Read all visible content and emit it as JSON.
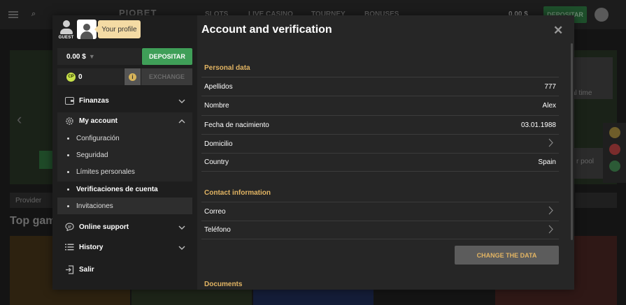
{
  "background": {
    "logo": "PIOBET",
    "nav": [
      "SLOTS",
      "LIVE CASINO",
      "TOURNEY",
      "BONUSES"
    ],
    "balance": "0.00 $",
    "deposit": "DEPOSITAR",
    "hero_side_1": "al time",
    "hero_side_2": "r pool",
    "provider": "Provider",
    "section_title": "Top game"
  },
  "sidebar": {
    "guest_label": "GUEST",
    "profile_tooltip": "Your profile",
    "balance": "0.00 $",
    "deposit_label": "DEPOSITAR",
    "cp_icon_text": "CP",
    "cp_points": "0",
    "exchange_label": "EXCHANGE",
    "menu": {
      "finanzas": "Finanzas",
      "my_account": "My account",
      "online_support": "Online support",
      "history": "History",
      "salir": "Salir"
    },
    "submenu": [
      "Configuración",
      "Seguridad",
      "Límites personales",
      "Verificaciones de cuenta",
      "Invitaciones"
    ]
  },
  "main": {
    "title": "Account and verification",
    "close_symbol": "✕",
    "personal_section": "Personal data",
    "personal_rows": [
      {
        "label": "Apellidos",
        "value": "777"
      },
      {
        "label": "Nombre",
        "value": "Alex"
      },
      {
        "label": "Fecha de nacimiento",
        "value": "03.01.1988"
      },
      {
        "label": "Domicilio",
        "value": ""
      },
      {
        "label": "Country",
        "value": "Spain"
      }
    ],
    "contact_section": "Contact information",
    "contact_rows": [
      {
        "label": "Correo"
      },
      {
        "label": "Teléfono"
      }
    ],
    "change_button": "CHANGE THE DATA",
    "documents_section": "Documents"
  },
  "colors": {
    "accent_gold": "#e3b563",
    "deposit_green": "#3f9f58",
    "panel": "#262626",
    "sidebar": "#1e1e1e"
  },
  "icons": [
    "guest-avatar-icon",
    "profile-avatar-icon",
    "caret-down-icon",
    "cp-coin-icon",
    "info-icon",
    "wallet-icon",
    "gear-icon",
    "chat-icon",
    "list-icon",
    "logout-icon",
    "chevron-down-icon",
    "chevron-up-icon",
    "chevron-right-icon",
    "close-icon"
  ]
}
